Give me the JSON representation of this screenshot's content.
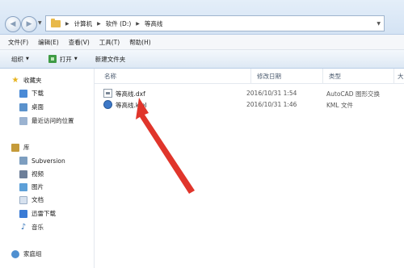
{
  "address_bar": {
    "crumbs": [
      "计算机",
      "软件 (D:)",
      "等高线"
    ]
  },
  "menu": [
    "文件(F)",
    "编辑(E)",
    "查看(V)",
    "工具(T)",
    "帮助(H)"
  ],
  "toolbar": {
    "organize": "组织",
    "open": "打开",
    "new_folder": "新建文件夹"
  },
  "sidebar": {
    "favorites": "收藏夹",
    "downloads": "下载",
    "desktop": "桌面",
    "recent": "最近访问的位置",
    "libraries": "库",
    "subversion": "Subversion",
    "videos": "视频",
    "pictures": "图片",
    "documents": "文档",
    "thunder": "迅雷下载",
    "music": "音乐",
    "homegroup": "家庭组"
  },
  "columns": {
    "name": "名称",
    "date": "修改日期",
    "type": "类型",
    "size": "大"
  },
  "files": [
    {
      "name": "等高线.dxf",
      "date": "2016/10/31 1:54",
      "type": "AutoCAD 图形交换"
    },
    {
      "name": "等高线.kml",
      "date": "2016/10/31 1:46",
      "type": "KML 文件"
    }
  ],
  "icons": {
    "dxf": "autocad-file-icon",
    "kml": "kml-file-icon",
    "open": "open-icon"
  },
  "colors": {
    "annotation_arrow": "#e0352b",
    "accent": "#3d78c7"
  }
}
